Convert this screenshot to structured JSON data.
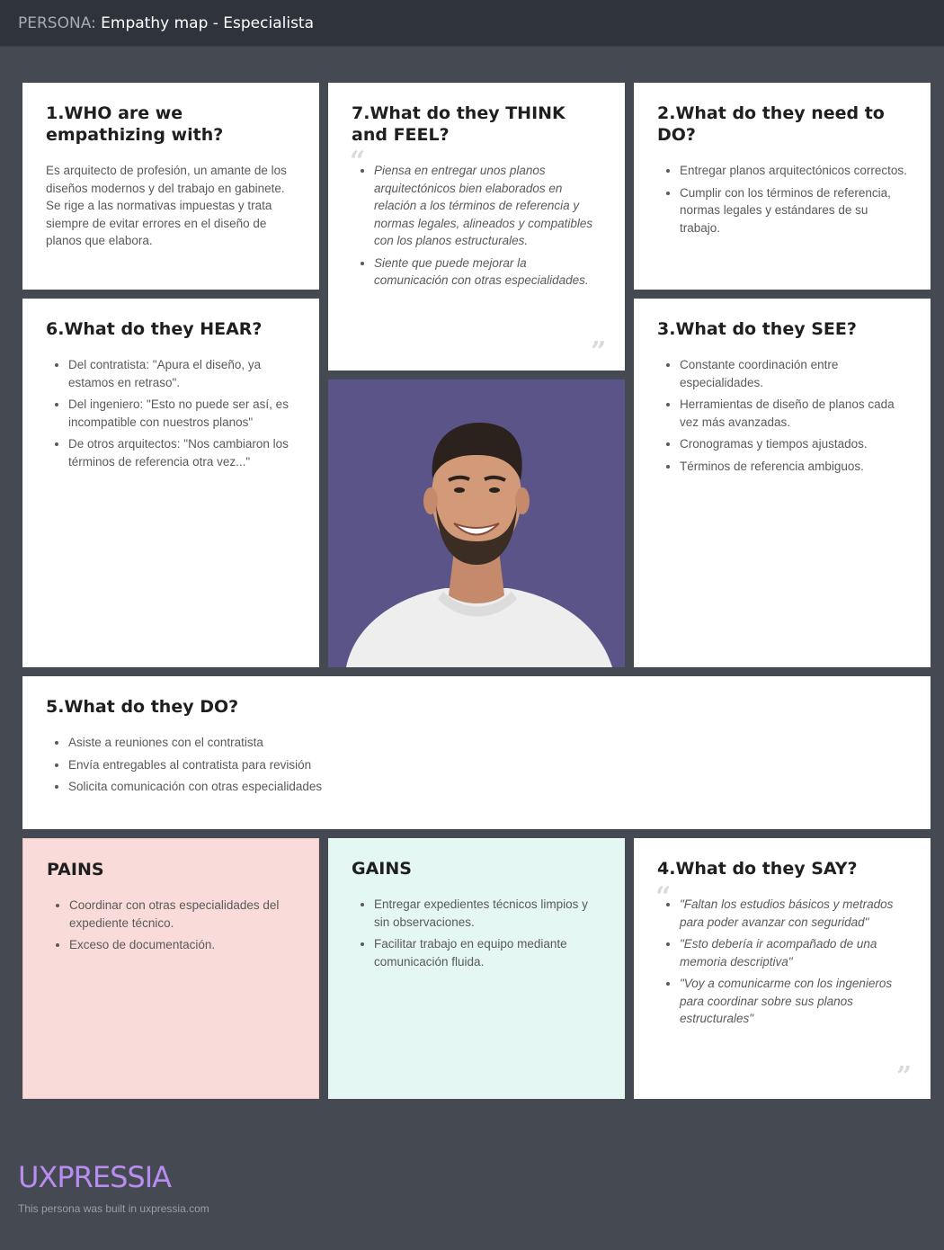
{
  "header": {
    "prefix": "PERSONA:",
    "title": "Empathy map - Especialista"
  },
  "who": {
    "heading": "1.WHO are we empathizing with?",
    "text": "Es arquitecto de profesión, un amante de los diseños modernos y del trabajo en gabinete. Se rige a las normativas impuestas y trata siempre de evitar errores en el diseño de planos que elabora."
  },
  "think_feel": {
    "heading": "7.What do they THINK and FEEL?",
    "items": [
      "Piensa en entregar unos planos arquitectónicos bien elaborados en relación a los términos de referencia y normas legales, alineados y compatibles con los planos estructurales.",
      "Siente que puede mejorar la comunicación con otras especialidades."
    ]
  },
  "need_do": {
    "heading": "2.What do they need to DO?",
    "items": [
      "Entregar planos arquitectónicos correctos.",
      "Cumplir con los términos de referencia, normas legales y estándares de su trabajo."
    ]
  },
  "hear": {
    "heading": "6.What do they HEAR?",
    "items": [
      "Del contratista: \"Apura el diseño, ya estamos en retraso\".",
      "Del ingeniero: \"Esto no puede ser así, es incompatible con nuestros planos\"",
      "De otros arquitectos: \"Nos cambiaron los términos de referencia otra vez...\""
    ]
  },
  "see": {
    "heading": "3.What do they SEE?",
    "items": [
      "Constante coordinación entre especialidades.",
      "Herramientas de diseño de planos cada vez más avanzadas.",
      "Cronogramas y tiempos ajustados.",
      "Términos de referencia ambiguos."
    ]
  },
  "do": {
    "heading": "5.What do they DO?",
    "items": [
      "Asiste a reuniones con el contratista",
      "Envía entregables al contratista para revisión",
      "Solicita comunicación con otras especialidades"
    ]
  },
  "pains": {
    "heading": "PAINS",
    "items": [
      "Coordinar con otras especialidades del expediente técnico.",
      "Exceso de documentación."
    ]
  },
  "gains": {
    "heading": "GAINS",
    "items": [
      "Entregar expedientes técnicos limpios y sin observaciones.",
      "Facilitar trabajo en equipo mediante comunicación fluida."
    ]
  },
  "say": {
    "heading": "4.What do they SAY?",
    "items": [
      "\"Faltan los estudios básicos y metrados para poder avanzar con seguridad\"",
      "\"Esto debería ir acompañado de una memoria descriptiva\"",
      "\"Voy a comunicarme con los ingenieros para coordinar sobre sus planos estructurales\""
    ]
  },
  "quotes": {
    "open": "“",
    "close": "”"
  },
  "footer": {
    "logo": "UXPRESSIA",
    "note": "This persona was built in uxpressia.com"
  },
  "colors": {
    "background": "#454a52",
    "topbar": "#2f333b",
    "pains": "#f9dcd9",
    "gains": "#e4f7f3",
    "logo": "#b98cf0",
    "photo_bg": "#5a5489"
  },
  "photo": {
    "icon": "persona-photo"
  }
}
